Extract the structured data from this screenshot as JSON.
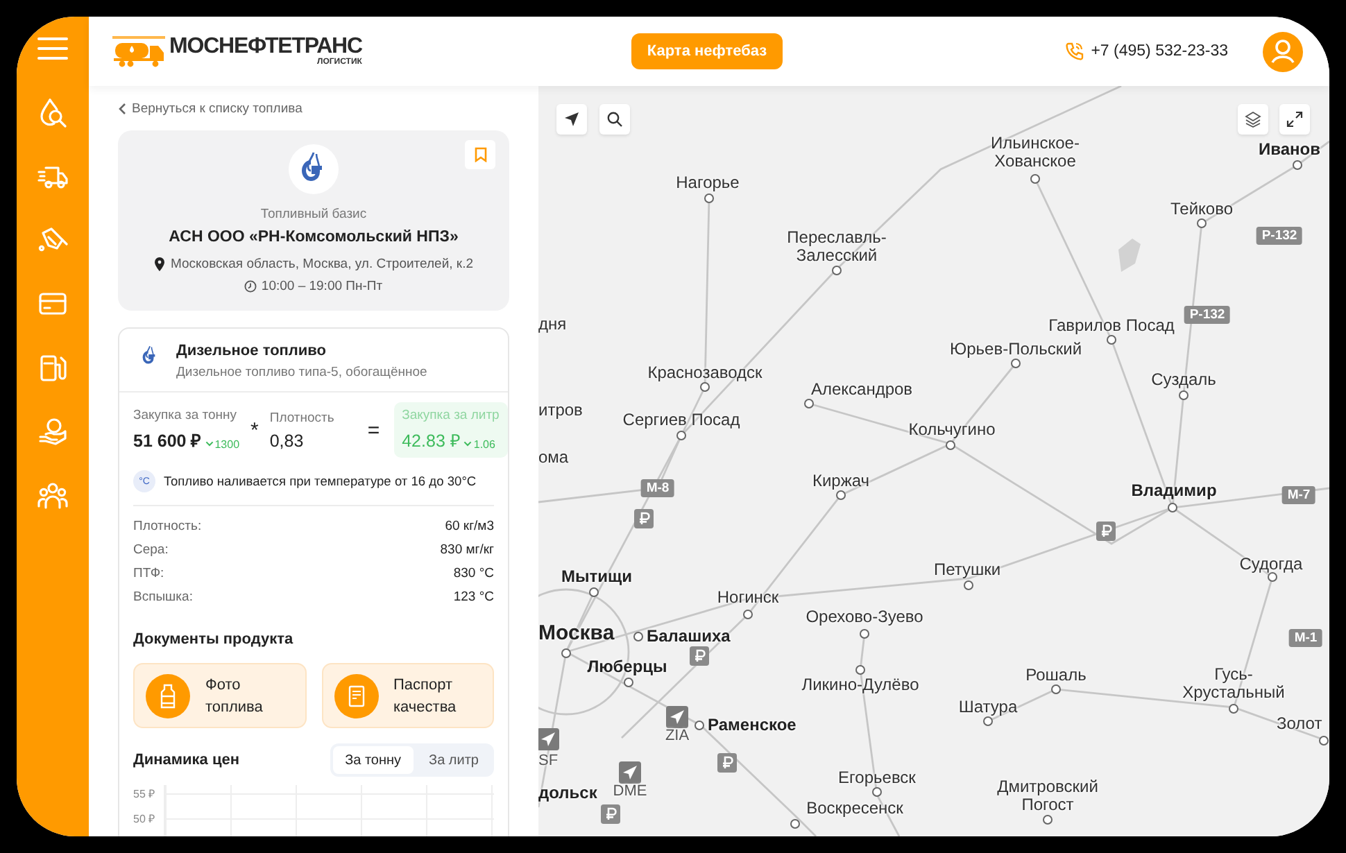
{
  "header": {
    "logo": {
      "title": "МОСНЕФТЕТРАНС",
      "subtitle": "ЛОГИСТИК"
    },
    "map_button": "Карта нефтебаз",
    "phone": "+7 (495) 532-23-33"
  },
  "back_link": "Вернуться к списку топлива",
  "supplier": {
    "type_label": "Топливный базис",
    "name": "АСН ООО «РН-Комсомольский НПЗ»",
    "address": "Московская область, Москва, ул. Строителей, к.2",
    "hours": "10:00 – 19:00 Пн-Пт"
  },
  "product": {
    "name": "Дизельное топливо",
    "description": "Дизельное топливо типа-5, обогащённое",
    "price": {
      "per_ton_label": "Закупка за тонну",
      "per_ton": "51 600 ₽",
      "per_ton_change": "1300",
      "multiply_sign": "*",
      "density_label": "Плотность",
      "density": "0,83",
      "equals_sign": "=",
      "per_liter_label": "Закупка за литр",
      "per_liter": "42.83 ₽",
      "per_liter_change": "1.06"
    },
    "temperature_badge": "°C",
    "temperature_note": "Топливо наливается при температуре от 16 до 30°C",
    "specs": [
      {
        "label": "Плотность:",
        "value": "60 кг/м3"
      },
      {
        "label": "Сера:",
        "value": "830 мг/кг"
      },
      {
        "label": "ПТФ:",
        "value": "830 °C"
      },
      {
        "label": "Вспышка:",
        "value": "123 °C"
      }
    ]
  },
  "documents": {
    "title": "Документы продукта",
    "items": [
      {
        "kind": "photo",
        "label": "Фото топлива"
      },
      {
        "kind": "passport",
        "label": "Паспорт качества"
      }
    ]
  },
  "price_chart": {
    "title": "Динамика цен",
    "tabs": [
      {
        "label": "За тонну",
        "selected": true
      },
      {
        "label": "За литр",
        "selected": false
      }
    ],
    "y_labels": [
      "55 ₽",
      "50 ₽"
    ]
  },
  "map": {
    "labels": [
      {
        "text": "Нагорье",
        "kind": "town"
      },
      {
        "text": "Ильинское-Хованское",
        "kind": "town"
      },
      {
        "text": "Иванов",
        "kind": "city"
      },
      {
        "text": "Тейково",
        "kind": "town"
      },
      {
        "text": "Переславль-Залесский",
        "kind": "town"
      },
      {
        "text": "дня",
        "kind": "town"
      },
      {
        "text": "Гаврилов Посад",
        "kind": "town"
      },
      {
        "text": "Юрьев-Польский",
        "kind": "town"
      },
      {
        "text": "Краснозаводск",
        "kind": "town"
      },
      {
        "text": "Александров",
        "kind": "town"
      },
      {
        "text": "Суздаль",
        "kind": "town"
      },
      {
        "text": "итров",
        "kind": "town"
      },
      {
        "text": "Сергиев Посад",
        "kind": "town"
      },
      {
        "text": "Кольчугино",
        "kind": "town"
      },
      {
        "text": "ома",
        "kind": "town"
      },
      {
        "text": "Киржач",
        "kind": "town"
      },
      {
        "text": "Владимир",
        "kind": "city"
      },
      {
        "text": "Судогда",
        "kind": "town"
      },
      {
        "text": "Петушки",
        "kind": "town"
      },
      {
        "text": "Мытищи",
        "kind": "city"
      },
      {
        "text": "Ногинск",
        "kind": "town"
      },
      {
        "text": "Орехово-Зуево",
        "kind": "town"
      },
      {
        "text": "Москва",
        "kind": "capital"
      },
      {
        "text": "Балашиха",
        "kind": "city"
      },
      {
        "text": "Люберцы",
        "kind": "city"
      },
      {
        "text": "Ликино-Дулёво",
        "kind": "town"
      },
      {
        "text": "Рошаль",
        "kind": "town"
      },
      {
        "text": "Гусь-Хрустальный",
        "kind": "town"
      },
      {
        "text": "Шатура",
        "kind": "town"
      },
      {
        "text": "Раменское",
        "kind": "city"
      },
      {
        "text": "ZIA",
        "kind": "code"
      },
      {
        "text": "Золот",
        "kind": "town"
      },
      {
        "text": "SF",
        "kind": "code"
      },
      {
        "text": "дольск",
        "kind": "city"
      },
      {
        "text": "DME",
        "kind": "code"
      },
      {
        "text": "Егорьевск",
        "kind": "town"
      },
      {
        "text": "Воскресенск",
        "kind": "town"
      },
      {
        "text": "Дмитровский Погост",
        "kind": "town"
      }
    ],
    "road_numbers": [
      "Р-132",
      "Р-132",
      "М-8",
      "М-7",
      "М-1"
    ]
  }
}
